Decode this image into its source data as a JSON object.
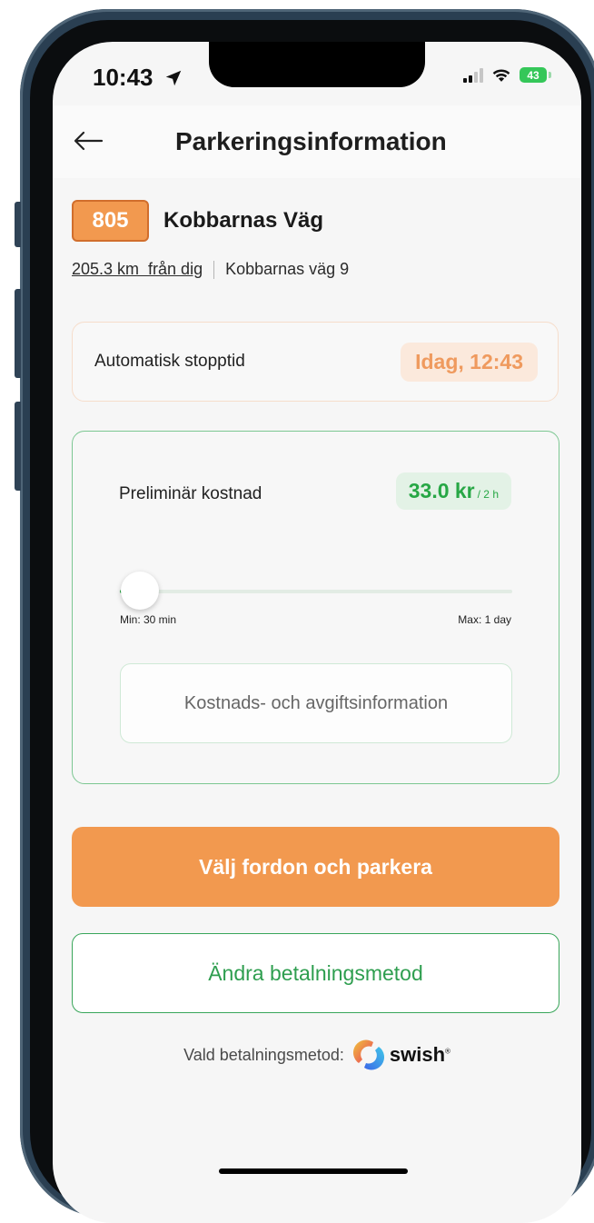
{
  "status_bar": {
    "time": "10:43",
    "battery": "43",
    "location_icon": "location-arrow-icon",
    "signal_icon": "cellular-signal-icon",
    "wifi_icon": "wifi-icon"
  },
  "header": {
    "title": "Parkeringsinformation",
    "back_icon": "back-arrow-icon"
  },
  "zone": {
    "code": "805",
    "street": "Kobbarnas Väg",
    "distance": "205.3 km  från dig",
    "address": "Kobbarnas väg 9"
  },
  "stop_time": {
    "label": "Automatisk stopptid",
    "value": "Idag, 12:43"
  },
  "cost": {
    "label": "Preliminär kostnad",
    "amount": "33.0 kr",
    "unit": "/ 2 h",
    "slider_min": "Min: 30 min",
    "slider_max": "Max: 1 day",
    "slider_position": 0.05,
    "info_button": "Kostnads- och avgiftsinformation"
  },
  "actions": {
    "primary": "Välj fordon och parkera",
    "secondary": "Ändra betalningsmetod"
  },
  "payment": {
    "label": "Vald betalningsmetod:",
    "provider": "swish",
    "provider_mark": "®"
  },
  "colors": {
    "accent_orange": "#f2994f",
    "accent_green": "#28a745",
    "background": "#f6f6f6"
  }
}
